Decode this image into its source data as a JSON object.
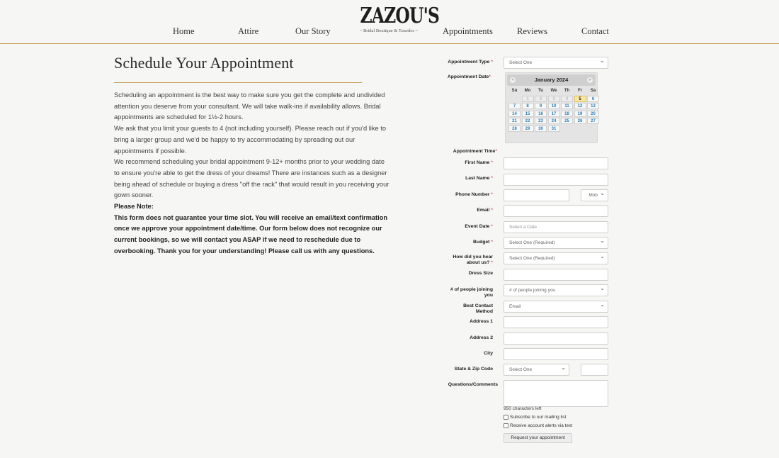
{
  "nav": {
    "home": "Home",
    "attire": "Attire",
    "our_story": "Our Story",
    "appointments": "Appointments",
    "reviews": "Reviews",
    "contact": "Contact"
  },
  "logo": {
    "main": "ZAZOU'S",
    "sub": "~ Bridal Boutique & Tuxedos ~"
  },
  "page_title": "Schedule Your Appointment",
  "intro": {
    "p1": "Scheduling an appointment is the best way to make sure you get the complete and undivided attention you deserve from your consultant. We will take walk-ins if availability allows. Bridal appointments are scheduled for 1½-2 hours.",
    "p2": "We ask that you limit your guests to 4 (not including yourself). Please reach out if you'd like to bring a larger group and we'd be happy to try accommodating by spreading out our appointments if possible.",
    "p3": "We recommend scheduling your bridal appointment 9-12+ months prior to your wedding date to ensure you're able to get the dress of your dreams! There are instances such as a designer being ahead of schedule or buying a dress \"off the rack\" that would result in you receiving your gown sooner.",
    "note_heading": "Please Note:",
    "note": "This form does not guarantee your time slot. You will receive an email/text confirmation once we approve your appointment date/time. Our form below does not recognize our current bookings, so we will contact you ASAP if we need to reschedule due to overbooking. Thank you for your understanding! Please call us with any questions."
  },
  "form": {
    "required_mark": "*",
    "appointment_type": {
      "label": "Appointment Type",
      "value": "Select One"
    },
    "appointment_date": {
      "label": "Appointment Date"
    },
    "calendar": {
      "month": "January 2024",
      "prev": "<",
      "next": ">",
      "dow": [
        "Su",
        "Mo",
        "Tu",
        "We",
        "Th",
        "Fr",
        "Sa"
      ],
      "leading_empty": 1,
      "muted_days": [
        "1",
        "2",
        "3",
        "4"
      ],
      "today": "5",
      "days": [
        "1",
        "2",
        "3",
        "4",
        "5",
        "6",
        "7",
        "8",
        "9",
        "10",
        "11",
        "12",
        "13",
        "14",
        "15",
        "16",
        "17",
        "18",
        "19",
        "20",
        "21",
        "22",
        "23",
        "24",
        "25",
        "26",
        "27",
        "28",
        "29",
        "30",
        "31"
      ]
    },
    "appointment_time": {
      "label": "Appointment Time"
    },
    "first_name": {
      "label": "First Name"
    },
    "last_name": {
      "label": "Last Name"
    },
    "phone": {
      "label": "Phone Number",
      "carrier": "Mob"
    },
    "email": {
      "label": "Email"
    },
    "event_date": {
      "label": "Event Date",
      "placeholder": "Select a Date"
    },
    "budget": {
      "label": "Budget",
      "value": "Select One (Required)"
    },
    "hear_about": {
      "label_line1": "How did you hear",
      "label_line2": "about us?",
      "value": "Select One (Required)"
    },
    "dress_size": {
      "label": "Dress Size"
    },
    "people_joining": {
      "label_line1": "# of people joining",
      "label_line2": "you",
      "value": "# of people joining you"
    },
    "contact_method": {
      "label_line1": "Best Contact",
      "label_line2": "Method",
      "value": "Email"
    },
    "address1": {
      "label": "Address 1"
    },
    "address2": {
      "label": "Address 2"
    },
    "city": {
      "label": "City"
    },
    "state_zip": {
      "label": "State & Zip Code",
      "state_value": "Select One"
    },
    "comments": {
      "label": "Questions/Comments"
    },
    "chars_left": "950 characters left",
    "subscribe": "Subscribe to our mailing list",
    "alerts": "Receive account alerts via text",
    "submit": "Request your appointment"
  }
}
